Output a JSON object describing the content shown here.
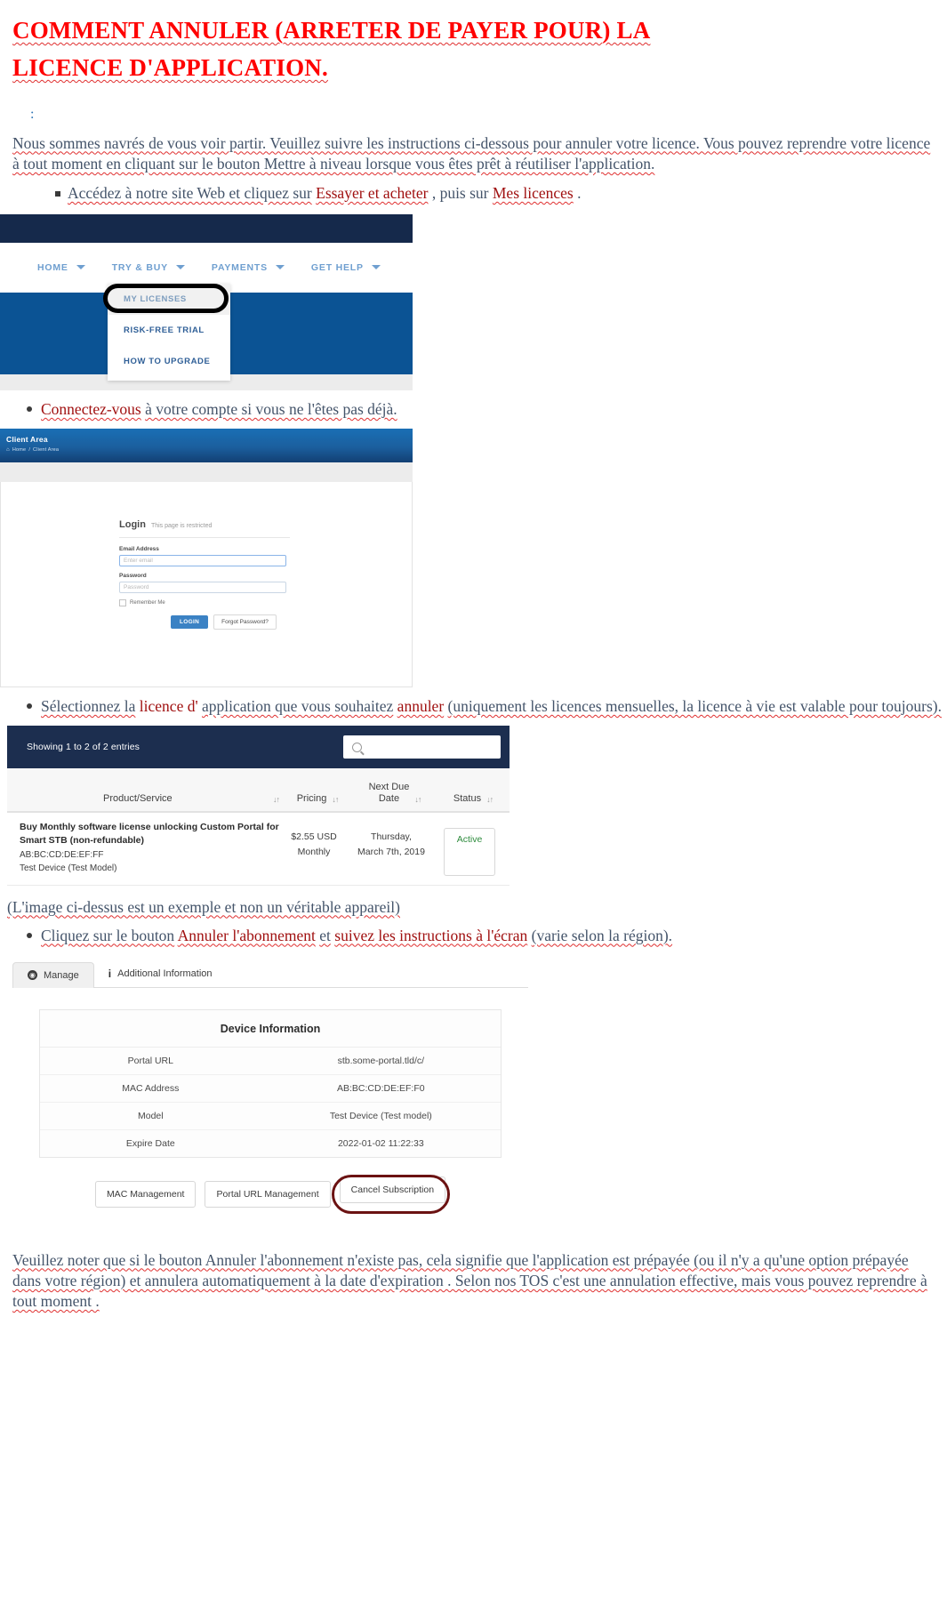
{
  "document": {
    "title_line1": "COMMENT ANNULER (ARRETER DE PAYER POUR) LA",
    "title_line2": "LICENCE D'APPLICATION.",
    "colon": ":",
    "intro": "Nous sommes navrés de vous voir partir. Veuillez suivre les instructions ci-dessous pour annuler votre licence. Vous pouvez reprendre votre licence à tout moment en cliquant sur le bouton Mettre à niveau lorsque vous êtes prêt à réutiliser l'application.",
    "step1_a": "Accédez à notre site Web et cliquez sur",
    "step1_link1": "Essayer et acheter",
    "step1_b": ", puis sur",
    "step1_link2": "Mes licences",
    "step1_c": ".",
    "step2_link": "Connectez-vous",
    "step2_text": "à votre compte si vous ne l'êtes pas déjà.",
    "step3_a": "Sélectionnez la",
    "step3_b": "licence d'",
    "step3_c": "application que   vous souhaitez",
    "step3_d": "annuler",
    "step3_e": "(uniquement les licences mensuelles, la licence à vie est valable pour toujours).",
    "caption_example": "(L'image ci-dessus est un exemple et non un véritable appareil)",
    "step4_a": "Cliquez sur le   bouton",
    "step4_b": "Annuler l'abonnement",
    "step4_c": "et",
    "step4_d": "suivez les instructions à l'écran",
    "step4_e": "(varie selon la région).",
    "footer_note": "Veuillez noter que si le bouton Annuler l'abonnement n'existe pas, cela signifie que l'application est prépayée (ou il n'y a qu'une option prépayée dans votre région) et annulera automatiquement à la date d'expiration . Selon nos TOS c'est une annulation effective, mais vous pouvez reprendre à tout moment ."
  },
  "site_nav": {
    "items": [
      {
        "label": "HOME",
        "has_caret": true
      },
      {
        "label": "TRY & BUY",
        "has_caret": true
      },
      {
        "label": "PAYMENTS",
        "has_caret": true
      },
      {
        "label": "GET HELP",
        "has_caret": true
      }
    ],
    "dropdown": [
      {
        "label": "MY LICENSES",
        "highlighted": true
      },
      {
        "label": "RISK-FREE TRIAL",
        "highlighted": false
      },
      {
        "label": "HOW TO UPGRADE",
        "highlighted": false
      }
    ]
  },
  "client_area": {
    "header_title": "Client Area",
    "breadcrumb_home": "Home",
    "breadcrumb_sep": "/",
    "breadcrumb_current": "Client Area",
    "login_heading": "Login",
    "login_sub": "This page is restricted",
    "email_label": "Email Address",
    "email_placeholder": "Enter email",
    "password_label": "Password",
    "password_placeholder": "Password",
    "remember_label": "Remember Me",
    "login_button": "LOGIN",
    "forgot_button": "Forgot Password?"
  },
  "licenses_table": {
    "showing": "Showing 1 to 2 of 2 entries",
    "search_placeholder": "",
    "search_icon": "search-icon",
    "columns": [
      {
        "label": "Product/Service",
        "sort": "↓↑"
      },
      {
        "label": "Pricing",
        "sort": "↓↑"
      },
      {
        "label_line1": "Next Due",
        "label_line2": "Date",
        "sort": "↓↑"
      },
      {
        "label": "Status",
        "sort": "↓↑"
      }
    ],
    "row": {
      "product_line1": "Buy Monthly software license unlocking Custom Portal for",
      "product_line2": "Smart STB (non-refundable)",
      "product_line3": "AB:BC:CD:DE:EF:FF",
      "product_line4": "Test Device (Test Model)",
      "price_line1": "$2.55 USD",
      "price_line2": "Monthly",
      "due_line1": "Thursday,",
      "due_line2": "March 7th, 2019",
      "status": "Active",
      "status_color": "#2e8b3d"
    }
  },
  "manage_panel": {
    "tabs": [
      {
        "label": "Manage",
        "icon": "globe-icon",
        "active": true
      },
      {
        "label": "Additional Information",
        "icon": "info-icon",
        "active": false
      }
    ],
    "device_info_title": "Device Information",
    "rows": [
      {
        "key": "Portal URL",
        "value": "stb.some-portal.tld/c/"
      },
      {
        "key": "MAC Address",
        "value": "AB:BC:CD:DE:EF:F0"
      },
      {
        "key": "Model",
        "value": "Test Device (Test model)"
      },
      {
        "key": "Expire Date",
        "value": "2022-01-02 11:22:33"
      }
    ],
    "buttons": [
      {
        "label": "MAC Management",
        "highlighted": false
      },
      {
        "label": "Portal URL Management",
        "highlighted": false
      },
      {
        "label": "Cancel Subscription",
        "highlighted": true
      }
    ]
  },
  "colors": {
    "title_red": "#ff0000",
    "body_blue": "#44546a",
    "link_red": "#a01010",
    "nav_dark": "#15294b",
    "nav_blue": "#0b5394",
    "table_header": "#1c2e4f",
    "highlight_ring": "#6b1212"
  }
}
